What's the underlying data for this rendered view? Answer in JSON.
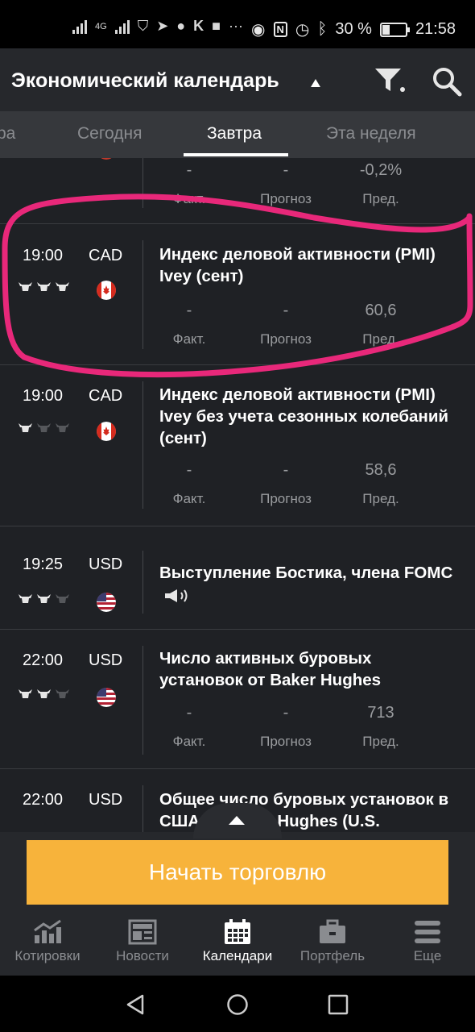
{
  "status_bar": {
    "network": "4G",
    "battery": "30 %",
    "time": "21:58",
    "icons": [
      "signal-icon",
      "shield-icon",
      "telegram-icon",
      "chat-icon",
      "k-icon",
      "video-icon",
      "more-dots-icon",
      "eye-icon",
      "nfc-icon",
      "alarm-icon",
      "bluetooth-icon",
      "battery-icon"
    ]
  },
  "header": {
    "title": "Экономический календарь",
    "icons": [
      "filter-icon",
      "search-icon"
    ]
  },
  "tabs": [
    "ра",
    "Сегодня",
    "Завтра",
    "Эта неделя"
  ],
  "active_tab": "Завтра",
  "labels": {
    "actual": "Факт.",
    "forecast": "Прогноз",
    "previous": "Пред."
  },
  "events": [
    {
      "time": "",
      "currency": "",
      "title": "",
      "actual": "-",
      "forecast": "-",
      "previous": "-0,2%",
      "importance": 0
    },
    {
      "time": "19:00",
      "currency": "CAD",
      "title": "Индекс деловой активности (PMI) Ivey (сент)",
      "actual": "-",
      "forecast": "-",
      "previous": "60,6",
      "importance": 3
    },
    {
      "time": "19:00",
      "currency": "CAD",
      "title": "Индекс деловой активности (PMI) Ivey без учета сезонных колебаний (сент)",
      "actual": "-",
      "forecast": "-",
      "previous": "58,6",
      "importance": 1
    },
    {
      "time": "19:25",
      "currency": "USD",
      "title": "Выступление Бостика, члена FOMC",
      "importance": 2
    },
    {
      "time": "22:00",
      "currency": "USD",
      "title": "Число активных буровых установок от Baker Hughes",
      "actual": "-",
      "forecast": "-",
      "previous": "713",
      "importance": 2
    },
    {
      "time": "22:00",
      "currency": "USD",
      "title": "Общее число буровых установок в США от Baker Hughes (U.S.",
      "importance": 2
    }
  ],
  "cta": "Начать торговлю",
  "bottom_nav": [
    "Котировки",
    "Новости",
    "Календари",
    "Портфель",
    "Еще"
  ],
  "bottom_nav_active": "Календари",
  "colors": {
    "accent": "#f7b33b",
    "highlight": "#e8287a",
    "background": "#1f2125"
  }
}
